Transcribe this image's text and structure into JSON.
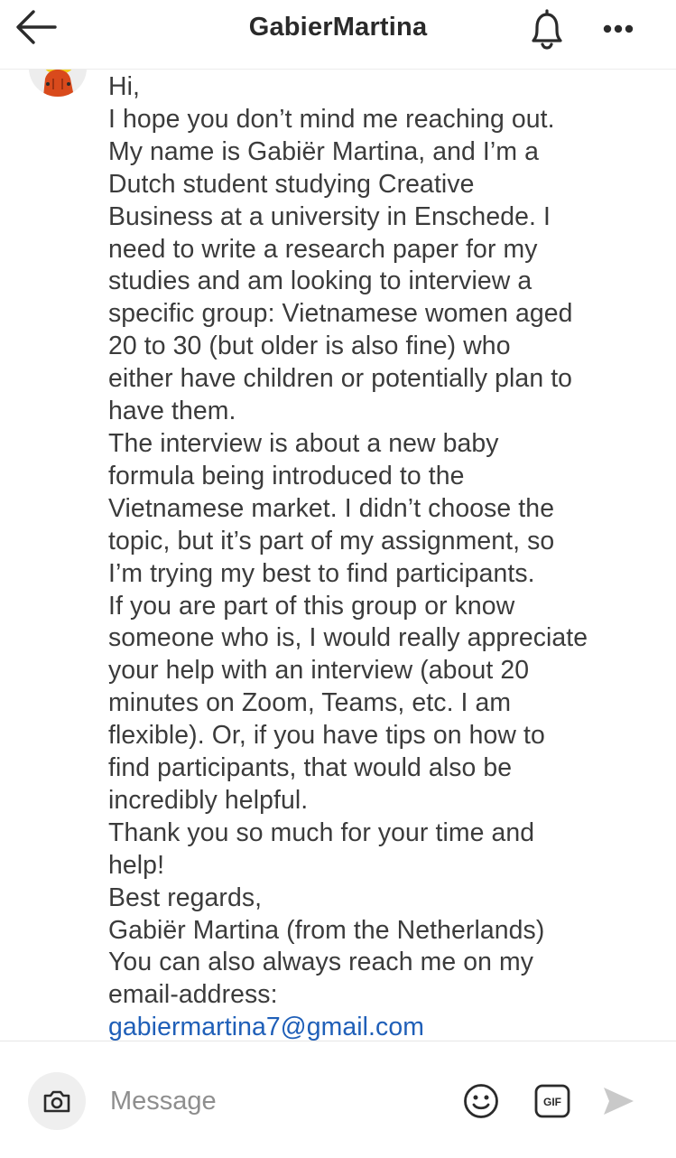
{
  "header": {
    "title": "GabierMartina",
    "icons": {
      "back": "arrow-left-icon",
      "notifications": "bell-icon",
      "more": "more-horizontal-icon"
    }
  },
  "conversation": {
    "avatar_icon": "avatar-cartoon-icon",
    "message_lines": [
      "Hi,",
      "I hope you don’t mind me reaching out.",
      "My name is Gabiër Martina, and I’m a",
      "Dutch student studying Creative",
      "Business at a university in Enschede. I",
      "need to write a research paper for my",
      "studies and am looking to interview a",
      "specific group: Vietnamese women aged",
      "20 to 30 (but older is also fine) who",
      "either have children or potentially plan to",
      "have them.",
      "The interview is about a new baby",
      "formula being introduced to the",
      "Vietnamese market. I didn’t choose the",
      "topic, but it’s part of my assignment, so",
      "I’m trying my best to find participants.",
      "If you are part of this group or know",
      "someone who is, I would really appreciate",
      "your help with an interview (about 20",
      "minutes on Zoom, Teams, etc. I am",
      "flexible). Or, if you have tips on how to",
      "find participants, that would also be",
      "incredibly helpful.",
      "Thank you so much for your time and",
      "help!",
      "Best regards,",
      "Gabiër Martina (from the Netherlands)",
      "You can also always reach me on my",
      "email-address:"
    ],
    "email_link": "gabiermartina7@gmail.com",
    "link_color": "#1f5fb8"
  },
  "composer": {
    "placeholder": "Message",
    "camera_icon": "camera-icon",
    "emoji_icon": "smiley-icon",
    "gif_label": "GIF",
    "send_icon": "send-arrow-icon"
  }
}
